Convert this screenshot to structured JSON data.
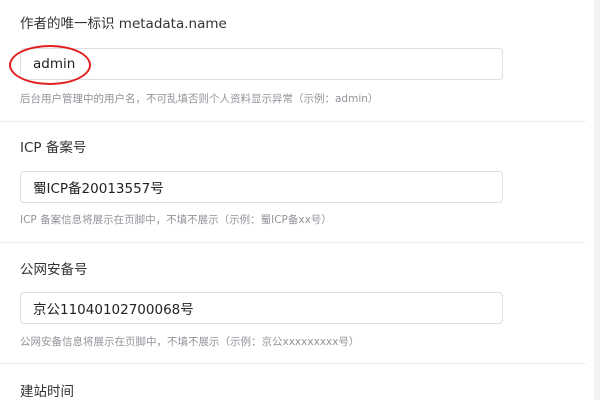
{
  "fields": [
    {
      "label": "作者的唯一标识 metadata.name",
      "value": "admin",
      "hint": "后台用户管理中的用户名，不可乱填否则个人资料显示异常（示例：admin）"
    },
    {
      "label": "ICP 备案号",
      "value": "蜀ICP备20013557号",
      "hint": "ICP 备案信息将展示在页脚中，不填不展示（示例：蜀ICP备xx号）"
    },
    {
      "label": "公网安备号",
      "value": "京公11040102700068号",
      "hint": "公网安备信息将展示在页脚中，不填不展示（示例：京公xxxxxxxxx号）"
    },
    {
      "label": "建站时间"
    }
  ],
  "colors": {
    "annotation": "#e0201f",
    "input_border": "#dcdfe6",
    "hint_text": "#909399",
    "divider": "#ebeef5"
  }
}
